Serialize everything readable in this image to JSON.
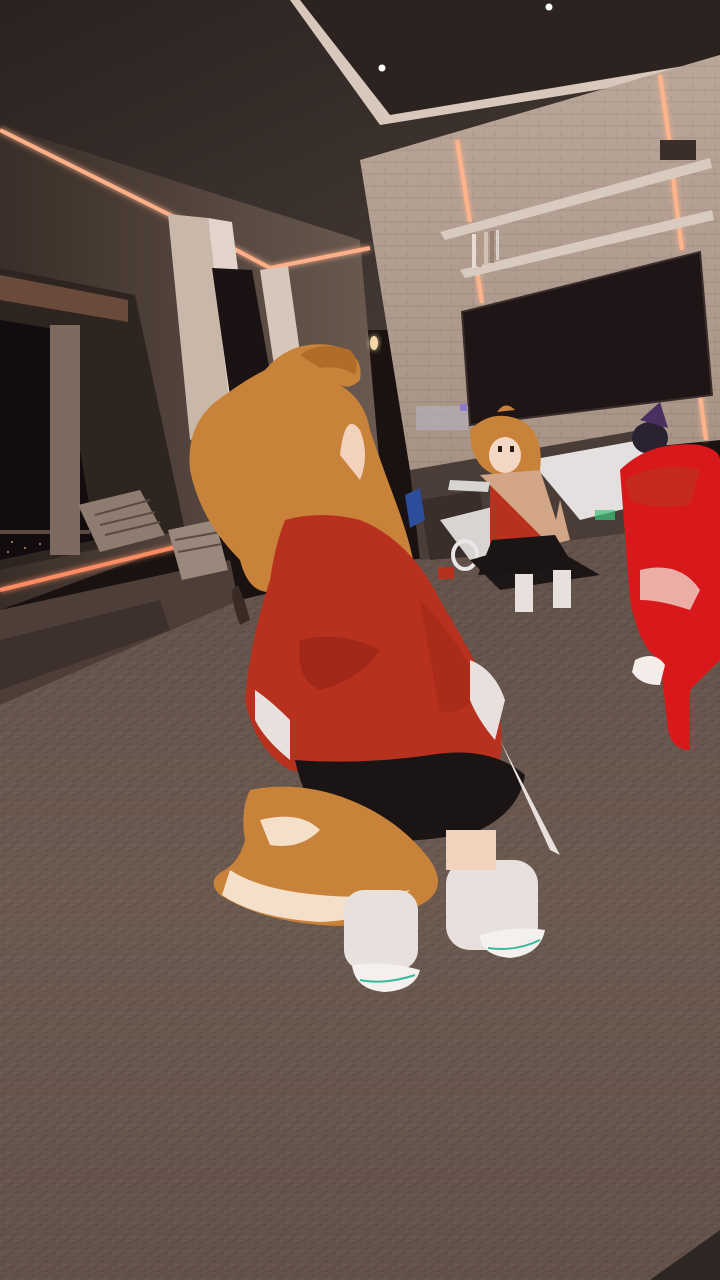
{
  "scene": {
    "type": "vr-room-screenshot",
    "environment": "penthouse-lounge",
    "colors": {
      "ceiling": "#3a302c",
      "wall_brick": "#b9a598",
      "led_strip": "#ff8a5c",
      "floor_carpet": "#6b5a50",
      "tv_screen": "#1f1416",
      "avatar_hair": "#c8823a",
      "avatar_hoodie": "#b8301e",
      "avatar_skirt": "#1a1414",
      "avatar_socks": "#e8e0dc",
      "red_avatar": "#d8181a"
    }
  }
}
